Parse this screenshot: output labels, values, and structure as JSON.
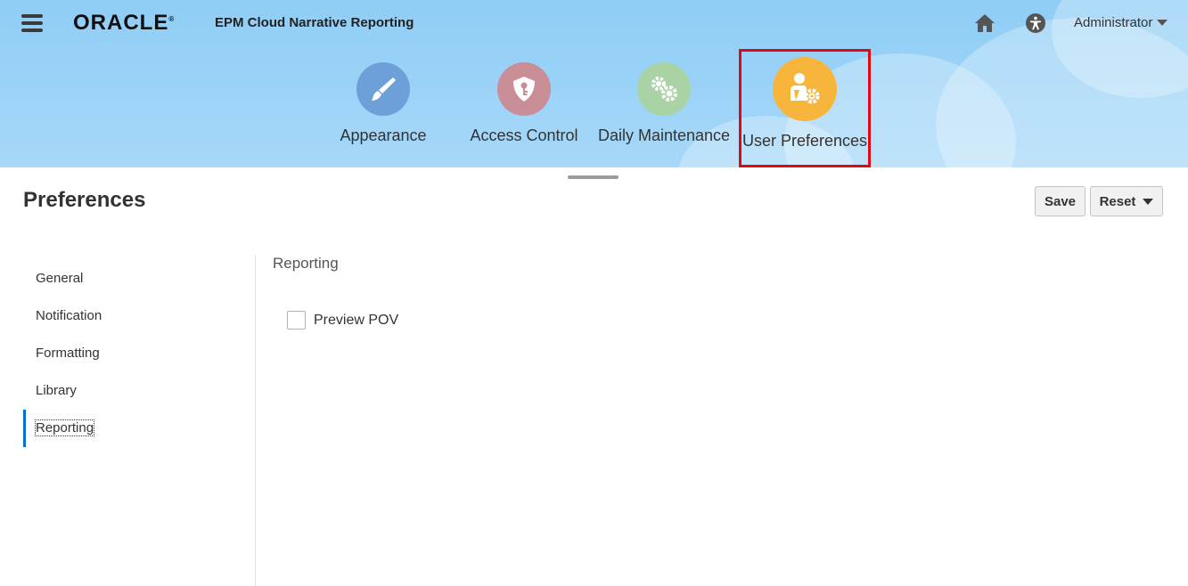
{
  "header": {
    "logo": "ORACLE",
    "app_title": "EPM Cloud Narrative Reporting",
    "user_menu_label": "Administrator",
    "nav_tiles": [
      {
        "label": "Appearance",
        "color": "#6d9fd8",
        "icon": "paintbrush-icon"
      },
      {
        "label": "Access Control",
        "color": "#c98d95",
        "icon": "shield-key-icon"
      },
      {
        "label": "Daily Maintenance",
        "color": "#a9d3a5",
        "icon": "gears-icon"
      },
      {
        "label": "User Preferences",
        "color": "#f7b53b",
        "icon": "user-gear-icon",
        "selected": true
      }
    ]
  },
  "page": {
    "title": "Preferences",
    "save_label": "Save",
    "reset_label": "Reset"
  },
  "side_nav": {
    "items": [
      {
        "label": "General"
      },
      {
        "label": "Notification"
      },
      {
        "label": "Formatting"
      },
      {
        "label": "Library"
      },
      {
        "label": "Reporting",
        "active": true
      }
    ]
  },
  "content": {
    "section_title": "Reporting",
    "checkbox_label": "Preview POV",
    "checkbox_checked": false
  },
  "colors": {
    "header_bg": "#8fcdf6",
    "active_accent": "#0572ce",
    "highlight_border": "#e30613"
  }
}
